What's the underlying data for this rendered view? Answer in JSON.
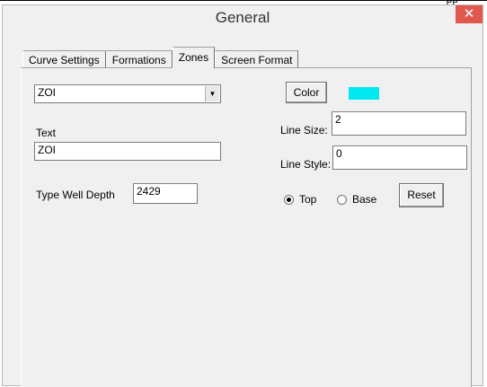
{
  "top_strip_text": "pp",
  "window": {
    "title": "General",
    "close_glyph": "✕"
  },
  "tabs": [
    {
      "label": "Curve Settings",
      "active": false
    },
    {
      "label": "Formations",
      "active": false
    },
    {
      "label": "Zones",
      "active": true
    },
    {
      "label": "Screen Format",
      "active": false
    }
  ],
  "zones": {
    "zone_select": {
      "value": "ZOI",
      "arrow_glyph": "▼"
    },
    "text_label": "Text",
    "text_value": "ZOI",
    "type_well_depth_label": "Type Well Depth",
    "type_well_depth_value": "2429",
    "color_button": "Color",
    "color_swatch": "#00e8f0",
    "line_size_label": "Line Size:",
    "line_size_value": "2",
    "line_style_label": "Line Style:",
    "line_style_value": "0",
    "radio_top_label": "Top",
    "radio_top_checked": true,
    "radio_base_label": "Base",
    "radio_base_checked": false,
    "reset_button": "Reset"
  }
}
